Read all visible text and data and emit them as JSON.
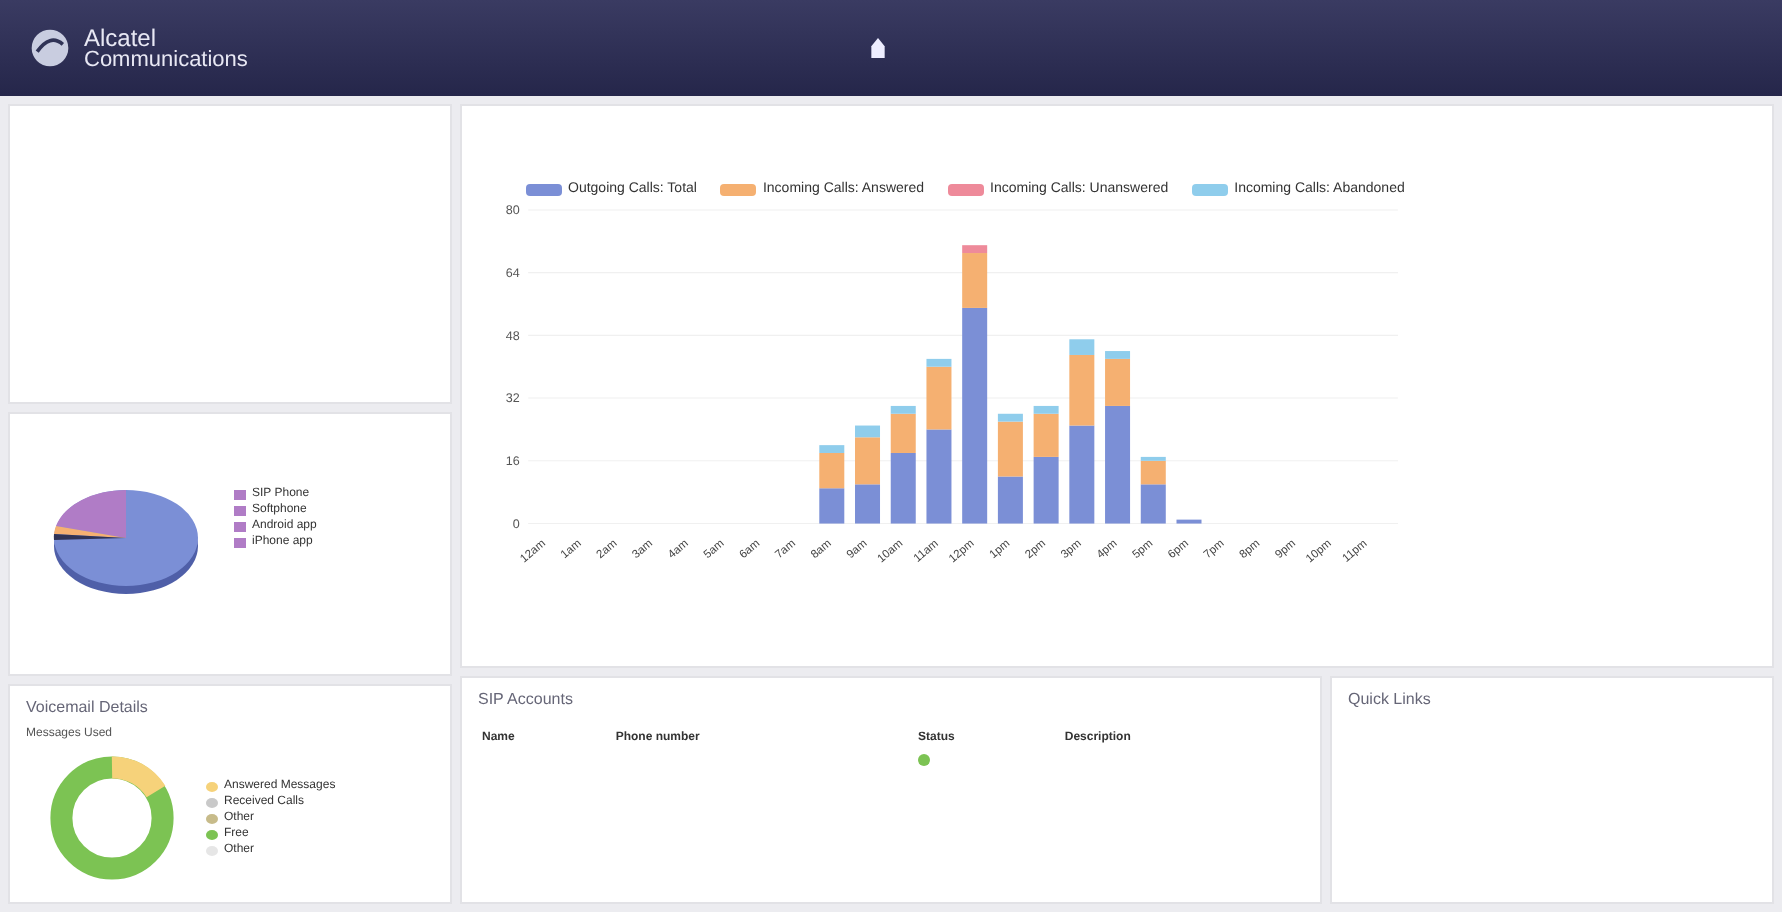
{
  "header": {
    "brand_line_1": "Alcatel",
    "brand_line_2": "Communications"
  },
  "pie_panel": {
    "legend": [
      "SIP Phone",
      "Softphone",
      "Android app",
      "iPhone app"
    ]
  },
  "voicemail_panel": {
    "title": "Voicemail Details",
    "subtitle": "Messages Used",
    "legend": [
      "Answered Messages",
      "Received Calls",
      "Other",
      "Free",
      "Other"
    ]
  },
  "calls_panel": {
    "chart_data": {
      "type": "bar",
      "stacked": true,
      "grid": true,
      "categories": [
        "12am",
        "1am",
        "2am",
        "3am",
        "4am",
        "5am",
        "6am",
        "7am",
        "8am",
        "9am",
        "10am",
        "11am",
        "12pm",
        "1pm",
        "2pm",
        "3pm",
        "4pm",
        "5pm",
        "6pm",
        "7pm",
        "8pm",
        "9pm",
        "10pm",
        "11pm"
      ],
      "ylim": [
        0,
        80
      ],
      "yticks": [
        0,
        16,
        32,
        48,
        64,
        80
      ],
      "series": [
        {
          "name": "Outgoing Calls: Total",
          "color": "#7b8fd6",
          "values": [
            0,
            0,
            0,
            0,
            0,
            0,
            0,
            0,
            9,
            10,
            18,
            24,
            55,
            12,
            17,
            25,
            30,
            10,
            1,
            0,
            0,
            0,
            0,
            0
          ]
        },
        {
          "name": "Incoming Calls: Answered",
          "color": "#f5b071",
          "values": [
            0,
            0,
            0,
            0,
            0,
            0,
            0,
            0,
            9,
            12,
            10,
            16,
            14,
            14,
            11,
            18,
            12,
            6,
            0,
            0,
            0,
            0,
            0,
            0
          ]
        },
        {
          "name": "Incoming Calls: Unanswered",
          "color": "#ee8a9a",
          "values": [
            0,
            0,
            0,
            0,
            0,
            0,
            0,
            0,
            0,
            0,
            0,
            0,
            2,
            0,
            0,
            0,
            0,
            0,
            0,
            0,
            0,
            0,
            0,
            0
          ]
        },
        {
          "name": "Incoming Calls: Abandoned",
          "color": "#8fcdec",
          "values": [
            0,
            0,
            0,
            0,
            0,
            0,
            0,
            0,
            2,
            3,
            2,
            2,
            0,
            2,
            2,
            4,
            2,
            1,
            0,
            0,
            0,
            0,
            0,
            0
          ]
        }
      ]
    }
  },
  "sip_panel": {
    "title": "SIP Accounts",
    "columns": [
      "Name",
      "Phone number",
      "Status",
      "Description"
    ],
    "rows": [
      {
        "color": "#7cc353"
      }
    ]
  },
  "links_panel": {
    "title": "Quick Links"
  }
}
